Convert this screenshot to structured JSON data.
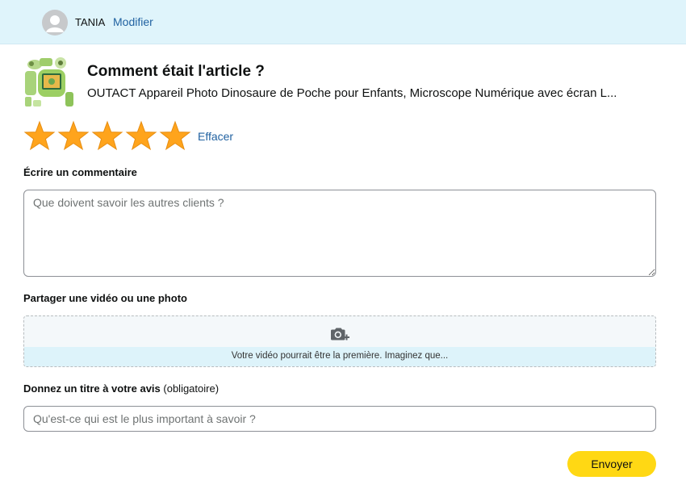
{
  "header": {
    "username": "TANIA",
    "modify_label": "Modifier"
  },
  "product": {
    "question": "Comment était l'article ?",
    "name": "OUTACT Appareil Photo Dinosaure de Poche pour Enfants, Microscope Numérique avec écran L..."
  },
  "rating": {
    "value": 5,
    "max": 5,
    "clear_label": "Effacer"
  },
  "comment": {
    "label": "Écrire un commentaire",
    "placeholder": "Que doivent savoir les autres clients ?",
    "value": ""
  },
  "media": {
    "label": "Partager une vidéo ou une photo",
    "hint": "Votre vidéo pourrait être la première. Imaginez que...",
    "icon": "camera-plus-icon"
  },
  "review_title": {
    "label": "Donnez un titre à votre avis",
    "label_suffix": "(obligatoire)",
    "placeholder": "Qu'est-ce qui est le plus important à savoir ?",
    "value": ""
  },
  "submit": {
    "label": "Envoyer"
  },
  "colors": {
    "header_bg": "#dff4fb",
    "link": "#2162a1",
    "star": "#ffa41c",
    "button": "#ffd814"
  }
}
